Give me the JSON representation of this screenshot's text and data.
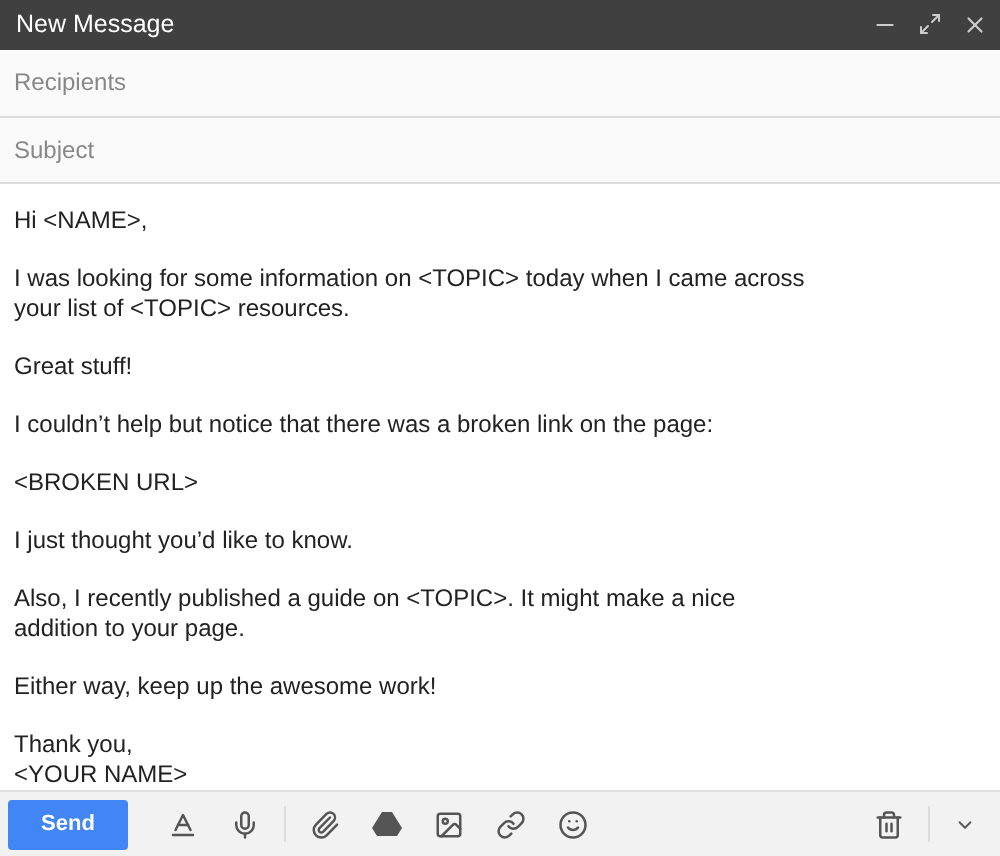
{
  "window": {
    "title": "New Message"
  },
  "recipients": {
    "placeholder": "Recipients"
  },
  "subject": {
    "placeholder": "Subject"
  },
  "body": [
    [
      "Hi <NAME>,"
    ],
    [
      "I was looking for some information on <TOPIC> today when I came across",
      "your list of <TOPIC> resources."
    ],
    [
      "Great stuff!"
    ],
    [
      "I couldn’t help but notice that there was a broken link on the page:"
    ],
    [
      "<BROKEN URL>"
    ],
    [
      "I just thought you’d like to know."
    ],
    [
      "Also, I recently published a guide on <TOPIC>. It might make a nice",
      "addition to your page."
    ],
    [
      "Either way, keep up the awesome work!"
    ],
    [
      "Thank you,",
      "<YOUR NAME>"
    ]
  ],
  "send_button": "Send"
}
